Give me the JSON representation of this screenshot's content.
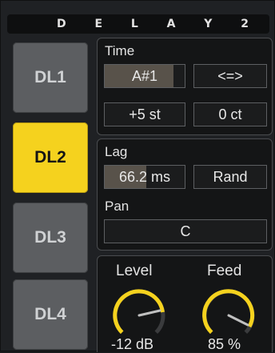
{
  "title_letters": [
    "D",
    "E",
    "L",
    "A",
    "Y",
    "2"
  ],
  "delay_buttons": [
    {
      "label": "DL1",
      "active": false
    },
    {
      "label": "DL2",
      "active": true
    },
    {
      "label": "DL3",
      "active": false
    },
    {
      "label": "DL4",
      "active": false
    }
  ],
  "time": {
    "label": "Time",
    "note": "A#1",
    "swap_label": "<=>",
    "semitones": "+5 st",
    "cents": "0 ct"
  },
  "lag": {
    "label": "Lag",
    "value": "66.2 ms",
    "rand_label": "Rand"
  },
  "pan": {
    "label": "Pan",
    "value": "C"
  },
  "level": {
    "label": "Level",
    "value": "-12 dB"
  },
  "feed": {
    "label": "Feed",
    "value": "85 %"
  },
  "colors": {
    "accent": "#f5d21e",
    "button_off": "#5c5e61",
    "panel": "#141516"
  }
}
